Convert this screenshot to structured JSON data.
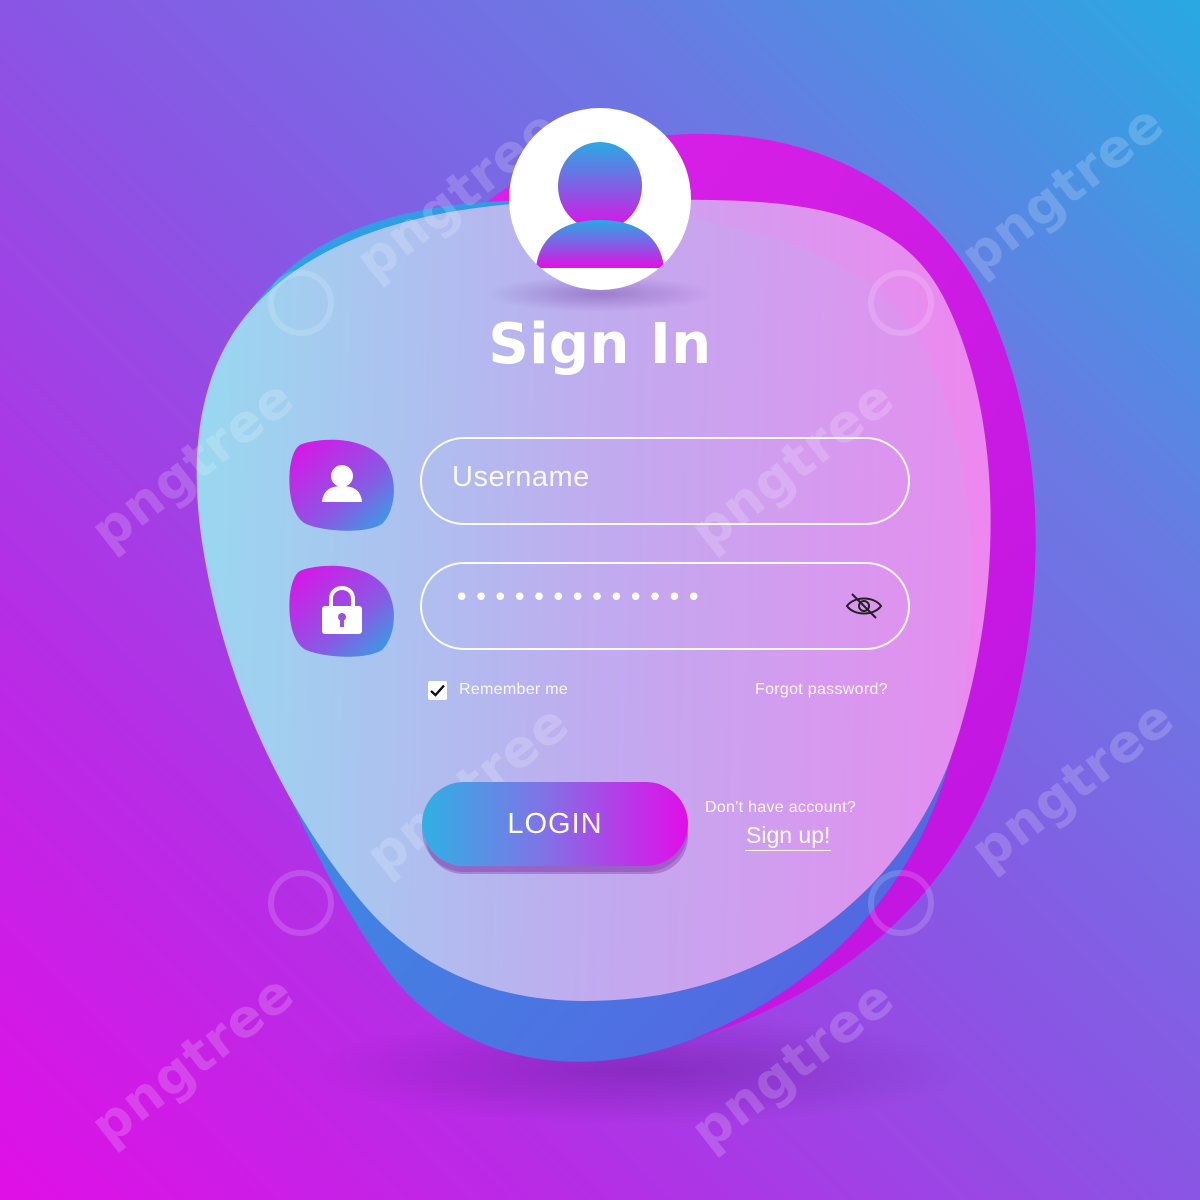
{
  "header": {
    "title": "Sign In"
  },
  "form": {
    "username_placeholder": "Username",
    "password_value": "•••••••••••••",
    "remember_label": "Remember me",
    "remember_checked": true,
    "forgot_label": "Forgot password?",
    "login_label": "LOGIN",
    "no_account_label": "Don't have account?",
    "signup_label": "Sign up!"
  },
  "icons": {
    "avatar": "user-avatar-icon",
    "username": "user-icon",
    "password": "lock-icon",
    "visibility": "eye-slash-icon",
    "checkbox": "checkmark-icon"
  },
  "watermark": {
    "text": "pngtree"
  },
  "colors": {
    "gradient_cyan": "#2fb0e4",
    "gradient_purple": "#8a55e4",
    "gradient_magenta": "#e10ee8",
    "text": "#ffffff"
  }
}
